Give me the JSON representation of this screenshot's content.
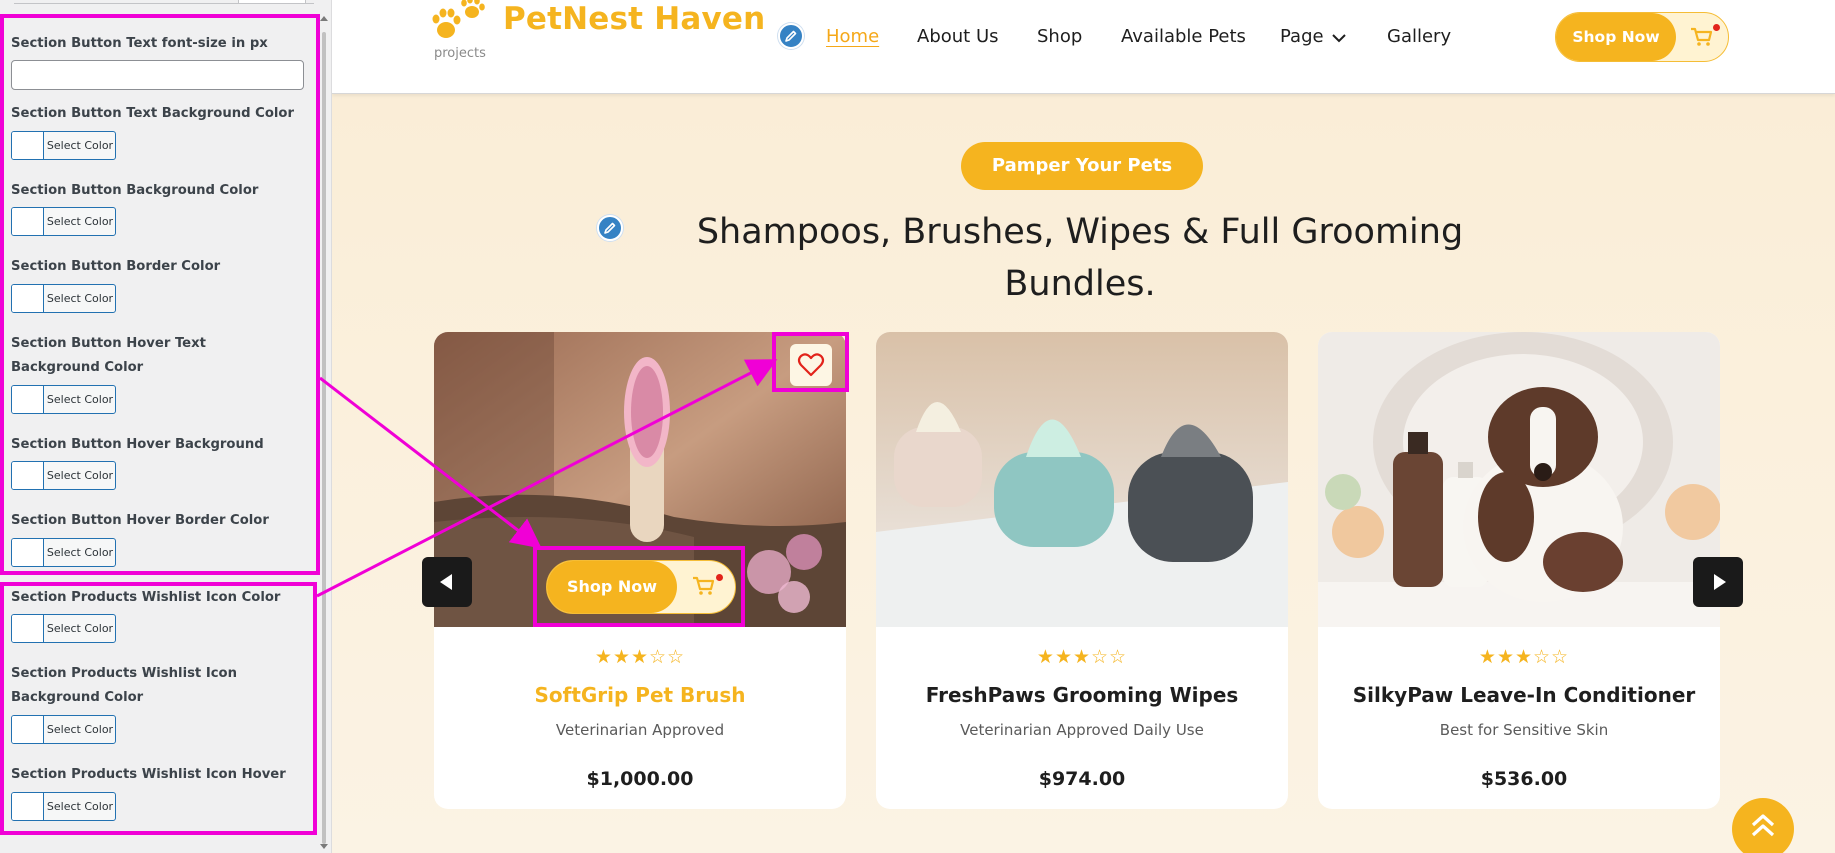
{
  "customizer": {
    "settings": [
      {
        "label": "Section Button Text font-size in px",
        "type": "text",
        "value": ""
      },
      {
        "label": "Section Button Text Background Color",
        "type": "color",
        "button": "Select Color"
      },
      {
        "label": "Section Button Background Color",
        "type": "color",
        "button": "Select Color"
      },
      {
        "label": "Section Button Border Color",
        "type": "color",
        "button": "Select Color"
      },
      {
        "label": "Section Button Hover Text Background Color",
        "type": "color",
        "button": "Select Color"
      },
      {
        "label": "Section Button Hover Background Color",
        "type": "color",
        "button": "Select Color"
      },
      {
        "label": "Section Button Hover Border Color",
        "type": "color",
        "button": "Select Color"
      },
      {
        "label": "Section Products Wishlist Icon Color",
        "type": "color",
        "button": "Select Color"
      },
      {
        "label": "Section Products Wishlist Icon Background Color",
        "type": "color",
        "button": "Select Color"
      },
      {
        "label": "Section Products Wishlist Icon Hover Color",
        "type": "color",
        "button": "Select Color"
      }
    ]
  },
  "site": {
    "logo": {
      "name": "PetNest Haven",
      "sub": "projects"
    },
    "nav": [
      {
        "label": "Home",
        "active": true
      },
      {
        "label": "About Us"
      },
      {
        "label": "Shop"
      },
      {
        "label": "Available Pets"
      },
      {
        "label": "Page",
        "dropdown": true
      },
      {
        "label": "Gallery"
      }
    ],
    "header_cta": "Shop Now",
    "section": {
      "tag": "Pamper Your Pets",
      "headline": "Shampoos, Brushes, Wipes & Full Grooming Bundles."
    },
    "products": [
      {
        "title": "SoftGrip Pet Brush",
        "subtitle": "Veterinarian Approved",
        "price": "$1,000.00",
        "rating": 3,
        "rating_max": 5,
        "cta": "Shop Now"
      },
      {
        "title": "FreshPaws Grooming Wipes",
        "subtitle": "Veterinarian Approved Daily Use",
        "price": "$974.00",
        "rating": 3,
        "rating_max": 5
      },
      {
        "title": "SilkyPaw Leave-In Conditioner",
        "subtitle": "Best for Sensitive Skin",
        "price": "$536.00",
        "rating": 3,
        "rating_max": 5
      }
    ],
    "icons": {
      "edit": "pencil-icon",
      "cart": "cart-icon",
      "wishlist": "heart-icon",
      "prev": "arrow-left-icon",
      "next": "arrow-right-icon",
      "scroll_top": "double-chevron-up-icon",
      "dropdown": "chevron-down-icon"
    }
  },
  "colors": {
    "brand": "#f5b41f",
    "annotation": "#f000d6",
    "panel_bg": "#f0f0f1",
    "wp_blue": "#2271b1"
  }
}
